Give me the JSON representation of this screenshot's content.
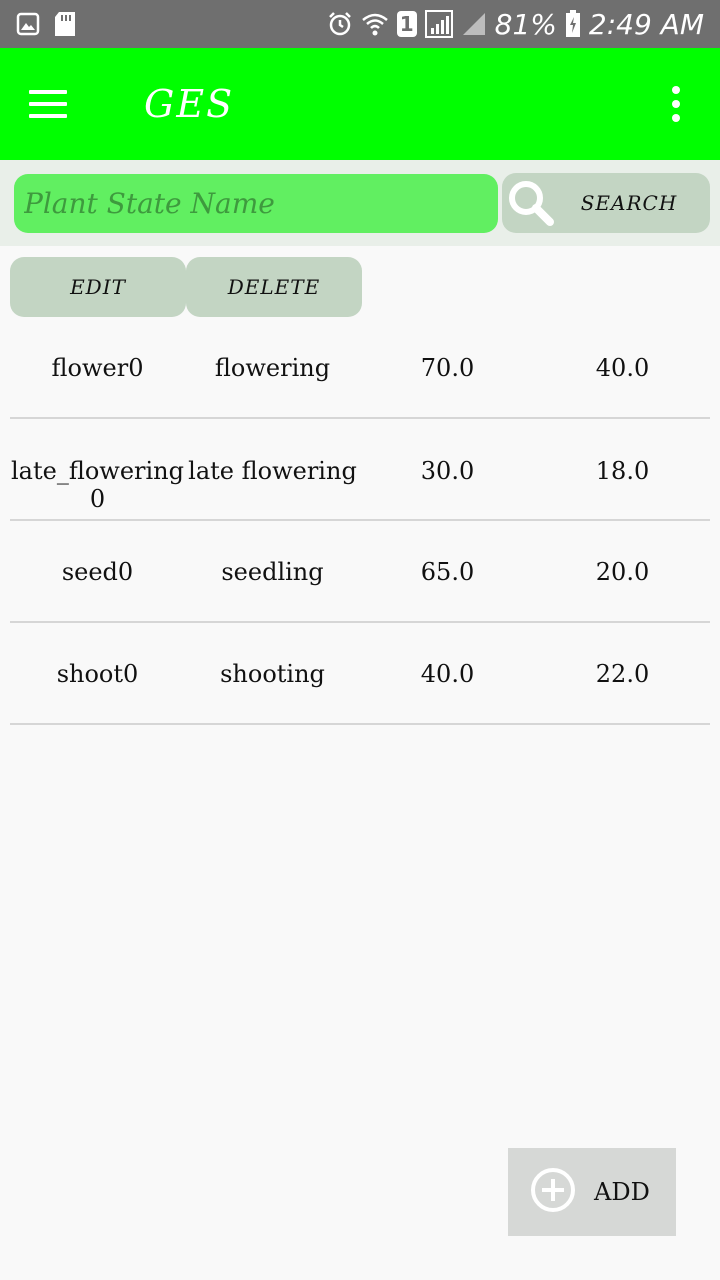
{
  "status_bar": {
    "battery": "81%",
    "time": "2:49 AM",
    "sim_badge": "1"
  },
  "app_bar": {
    "title": "GES"
  },
  "search": {
    "placeholder": "Plant State Name",
    "button_label": "SEARCH"
  },
  "actions": {
    "edit_label": "EDIT",
    "delete_label": "DELETE"
  },
  "table": {
    "rows": [
      [
        "flower0",
        "flowering",
        "70.0",
        "40.0"
      ],
      [
        "late_flowering 0",
        "late flowering",
        "30.0",
        "18.0"
      ],
      [
        "seed0",
        "seedling",
        "65.0",
        "20.0"
      ],
      [
        "shoot0",
        "shooting",
        "40.0",
        "22.0"
      ]
    ]
  },
  "fab": {
    "add_label": "ADD"
  },
  "colors": {
    "app_bar": "#00ff00",
    "search_field": "#61ef61",
    "button_bg": "#c3d5c3",
    "status_bar": "#6f6f6f"
  }
}
